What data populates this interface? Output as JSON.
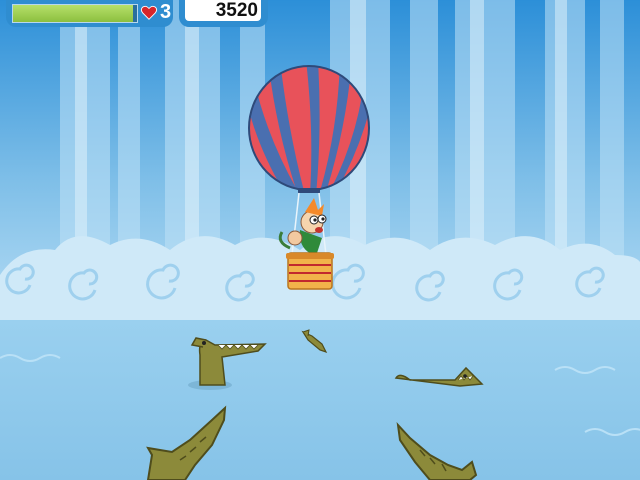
{
  "hud": {
    "health_level": 0.97,
    "lives_icon": "heart-icon",
    "lives": "3",
    "score": "3520"
  },
  "colors": {
    "sky_top": "#2b8ed6",
    "water": "#8ec8ea",
    "balloon_red": "#e8525a",
    "balloon_blue": "#4a6fb0",
    "crocodile": "#8c8a3a",
    "hud": "#2f8dd0"
  },
  "scene": {
    "player": "hot-air-balloon-with-pilot",
    "enemies": [
      "crocodile",
      "crocodile",
      "crocodile",
      "crocodile-tail",
      "crocodile-tail"
    ]
  }
}
